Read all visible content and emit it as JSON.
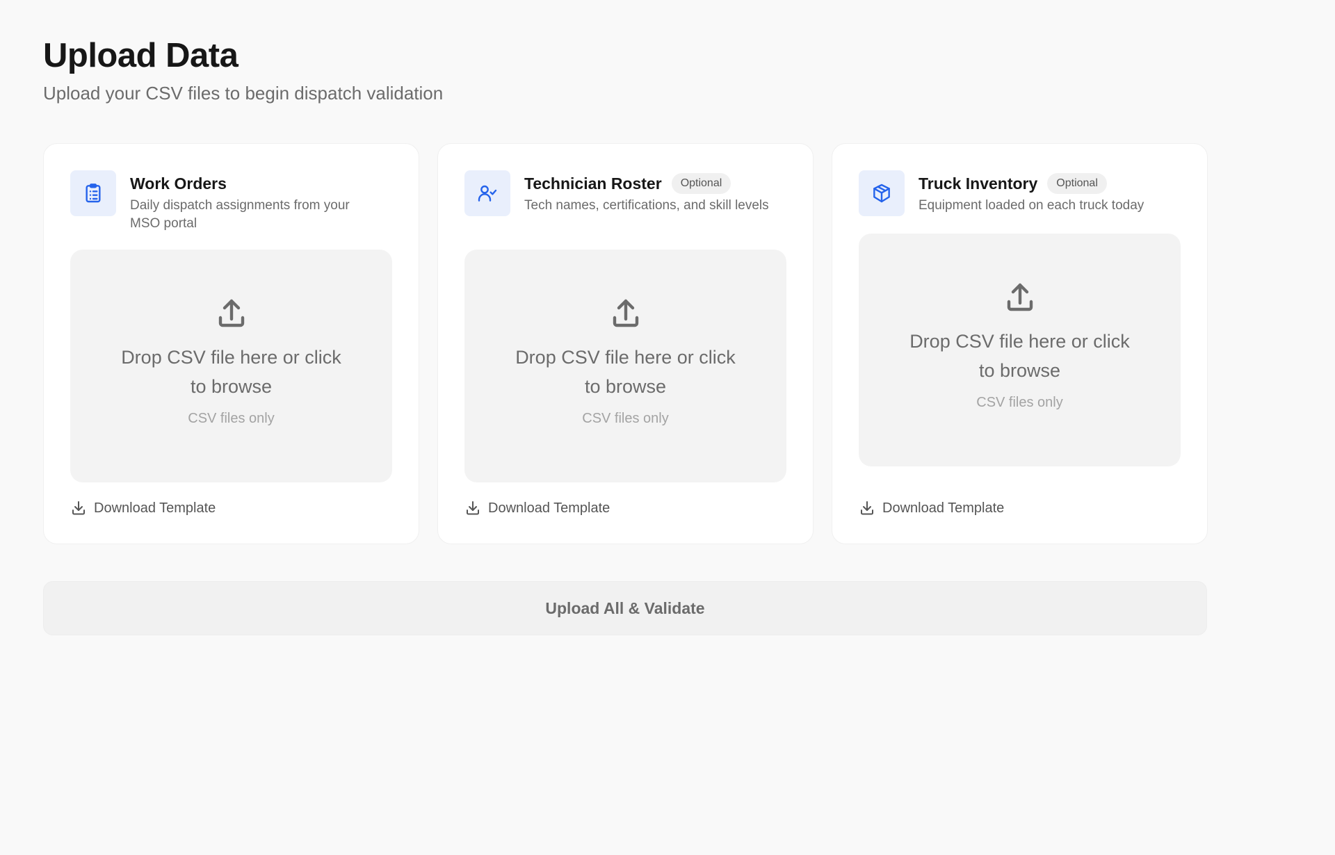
{
  "header": {
    "title": "Upload Data",
    "subtitle": "Upload your CSV files to begin dispatch validation"
  },
  "colors": {
    "accent": "#2563eb",
    "icon_bg": "#e9effc",
    "background": "#f9f9f9"
  },
  "cards": [
    {
      "title": "Work Orders",
      "badge": "",
      "description": "Daily dispatch assignments from your MSO portal",
      "icon": "clipboard-list-icon",
      "dropzone_text": "Drop CSV file here or click to browse",
      "dropzone_hint": "CSV files only",
      "download_label": "Download Template"
    },
    {
      "title": "Technician Roster",
      "badge": "Optional",
      "description": "Tech names, certifications, and skill levels",
      "icon": "user-check-icon",
      "dropzone_text": "Drop CSV file here or click to browse",
      "dropzone_hint": "CSV files only",
      "download_label": "Download Template"
    },
    {
      "title": "Truck Inventory",
      "badge": "Optional",
      "description": "Equipment loaded on each truck today",
      "icon": "package-icon",
      "dropzone_text": "Drop CSV file here or click to browse",
      "dropzone_hint": "CSV files only",
      "download_label": "Download Template"
    }
  ],
  "actions": {
    "upload_all_label": "Upload All & Validate"
  }
}
